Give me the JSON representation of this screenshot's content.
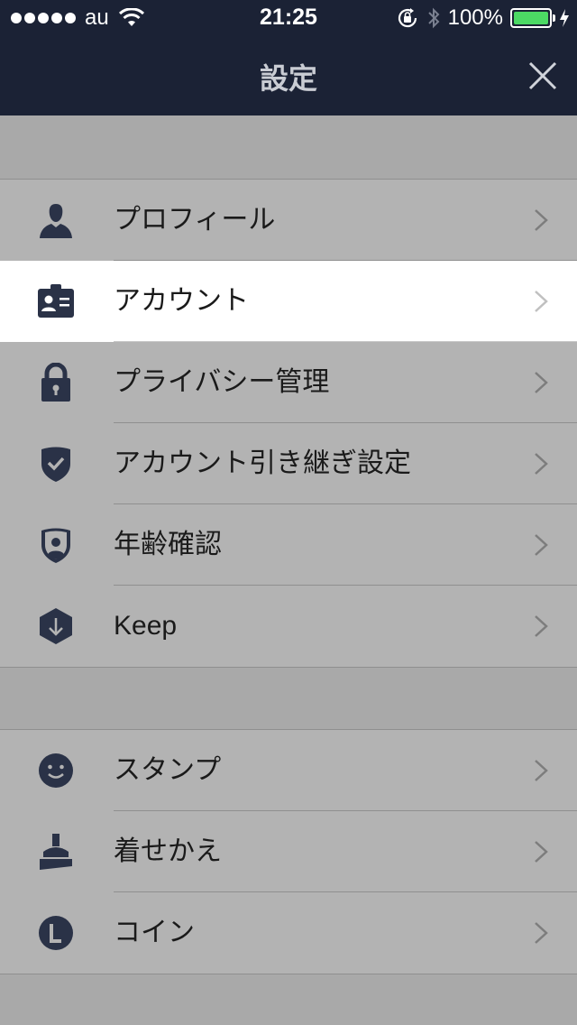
{
  "status_bar": {
    "carrier": "au",
    "time": "21:25",
    "battery": "100%"
  },
  "header": {
    "title": "設定"
  },
  "colors": {
    "nav_background": "#1b2235",
    "list_background": "#b3b3b3",
    "highlight_row": "#ffffff",
    "icon_color": "#2a3247",
    "battery_green": "#4cd964"
  },
  "sections": [
    {
      "items": [
        {
          "label": "プロフィール",
          "icon": "person-icon"
        },
        {
          "label": "アカウント",
          "icon": "id-card-icon",
          "highlighted": true
        },
        {
          "label": "プライバシー管理",
          "icon": "lock-icon"
        },
        {
          "label": "アカウント引き継ぎ設定",
          "icon": "shield-check-icon"
        },
        {
          "label": "年齢確認",
          "icon": "shield-person-icon"
        },
        {
          "label": "Keep",
          "icon": "keep-download-icon"
        }
      ]
    },
    {
      "items": [
        {
          "label": "スタンプ",
          "icon": "smiley-icon"
        },
        {
          "label": "着せかえ",
          "icon": "brush-icon"
        },
        {
          "label": "コイン",
          "icon": "coin-icon"
        }
      ]
    }
  ]
}
